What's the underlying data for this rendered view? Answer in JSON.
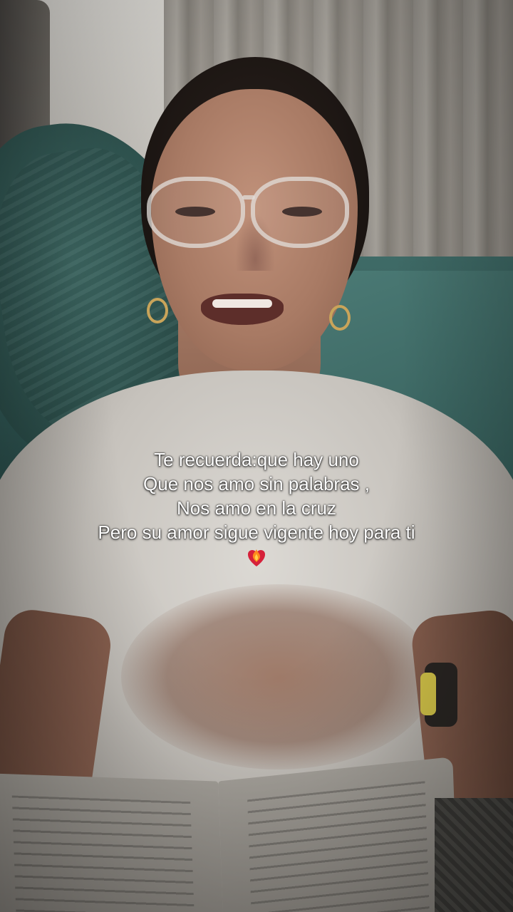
{
  "caption": {
    "lines": [
      "Te recuerda:que hay uno",
      "Que nos amo sin palabras ,",
      "Nos amo en la cruz",
      "Pero su amor sigue vigente hoy para ti"
    ],
    "emoji": "heart-on-fire-icon"
  },
  "colors": {
    "caption_text": "#ffffff",
    "bedding": "#3f6b67",
    "shirt": "#dcd9d4"
  }
}
